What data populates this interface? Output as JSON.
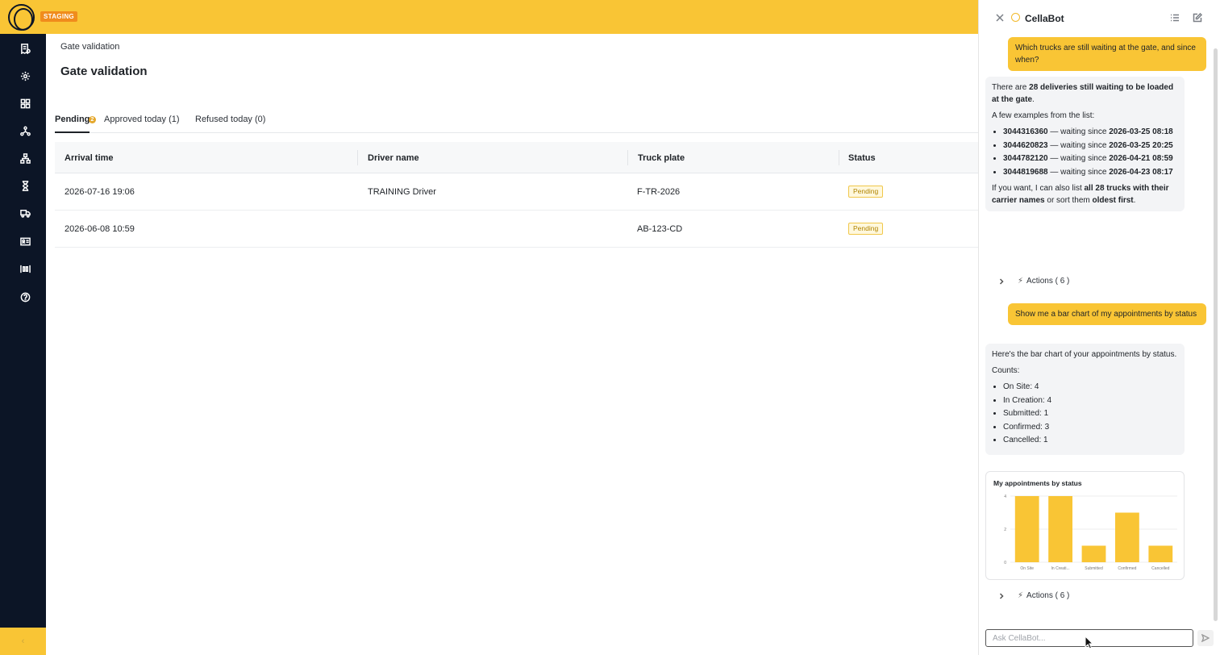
{
  "app": {
    "environment_badge": "STAGING"
  },
  "main": {
    "breadcrumb": "Gate validation",
    "title": "Gate validation",
    "tabs": [
      {
        "label": "Pending",
        "badge": "2"
      },
      {
        "label": "Approved today (1)"
      },
      {
        "label": "Refused today (0)"
      }
    ],
    "table": {
      "columns": [
        "Arrival time",
        "Driver name",
        "Truck plate",
        "Status"
      ],
      "rows": [
        {
          "arrival": "2026-07-16 19:06",
          "driver": "TRAINING Driver",
          "plate": "F-TR-2026",
          "status": "Pending"
        },
        {
          "arrival": "2026-06-08 10:59",
          "driver": "",
          "plate": "AB-123-CD",
          "status": "Pending"
        }
      ]
    }
  },
  "colors": {
    "brand_yellow": "#f9c535",
    "sidebar_navy": "#0c1526",
    "staging_orange": "#f08c1c",
    "pending_text": "#b08400"
  },
  "sidebar_icons": [
    "receipt-icon",
    "gear-icon",
    "dashboard-icon",
    "network-icon",
    "hierarchy-icon",
    "hourglass-icon",
    "truck-icon",
    "id-card-icon",
    "dock-icon",
    "help-icon"
  ],
  "chat": {
    "title": "CellaBot",
    "messages": {
      "user1": "Which trucks are still waiting at the gate, and since when?",
      "bot1": {
        "intro_pre": "There are ",
        "intro_bold": "28 deliveries still waiting to be loaded at the gate",
        "intro_post": ".",
        "examples_label": "A few examples from the list:",
        "examples": [
          {
            "id": "3044316360",
            "mid": " — waiting since ",
            "since": "2026-03-25 08:18"
          },
          {
            "id": "3044620823",
            "mid": " — waiting since ",
            "since": "2026-03-25 20:25"
          },
          {
            "id": "3044782120",
            "mid": " — waiting since ",
            "since": "2026-04-21 08:59"
          },
          {
            "id": "3044819688",
            "mid": " — waiting since ",
            "since": "2026-04-23 08:17"
          }
        ],
        "outro_pre": "If you want, I can also list ",
        "outro_bold1": "all 28 trucks with their carrier names",
        "outro_mid": " or sort them ",
        "outro_bold2": "oldest first",
        "outro_post": "."
      },
      "actions1": "Actions ( 6 )",
      "user2": "Show me a bar chart of my appointments by status",
      "bot2": {
        "intro": "Here's the bar chart of your appointments by status.",
        "counts_label": "Counts:",
        "counts": [
          "On Site: 4",
          "In Creation: 4",
          "Submitted: 1",
          "Confirmed: 3",
          "Cancelled: 1"
        ]
      },
      "actions2": "Actions ( 6 )"
    },
    "input_placeholder": "Ask CellaBot..."
  },
  "chart_data": {
    "type": "bar",
    "title": "My appointments by status",
    "categories": [
      "On Site",
      "In Creati...",
      "Submitted",
      "Confirmed",
      "Cancelled"
    ],
    "values": [
      4,
      4,
      1,
      3,
      1
    ],
    "ylim": [
      0,
      4
    ],
    "yticks": [
      0,
      2,
      4
    ],
    "xlabel": "",
    "ylabel": "",
    "grid": true,
    "bar_color": "#f9c535"
  }
}
